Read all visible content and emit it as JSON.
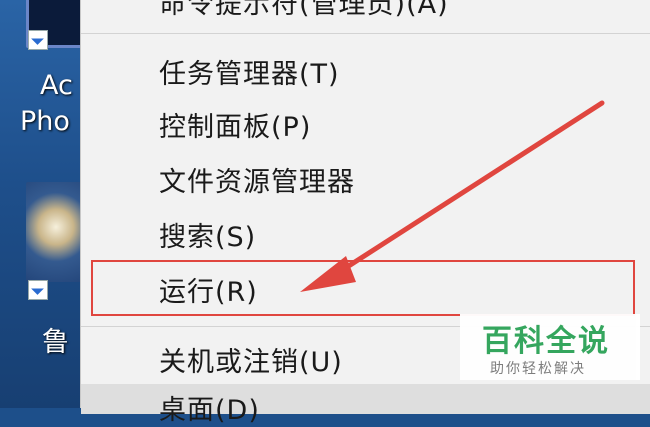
{
  "desktop": {
    "icons": [
      {
        "label": "Ac",
        "label2": "Pho",
        "icon": "photoshop-shortcut-icon"
      },
      {
        "label": "鲁",
        "icon": "game-shortcut-icon"
      }
    ]
  },
  "menu": {
    "items": [
      {
        "label": "命令提示符(管理员)(A)",
        "state": "partially visible"
      },
      {
        "label": "任务管理器(T)"
      },
      {
        "label": "控制面板(P)"
      },
      {
        "label": "文件资源管理器"
      },
      {
        "label": "搜索(S)"
      },
      {
        "label": "运行(R)",
        "highlighted": true
      },
      {
        "label": "关机或注销(U)"
      },
      {
        "label": "桌面(D)",
        "state": "partially visible"
      }
    ]
  },
  "annotation": {
    "color": "#e0463f"
  },
  "watermark": {
    "title": "百科全说",
    "subtitle": "助你轻松解决"
  }
}
